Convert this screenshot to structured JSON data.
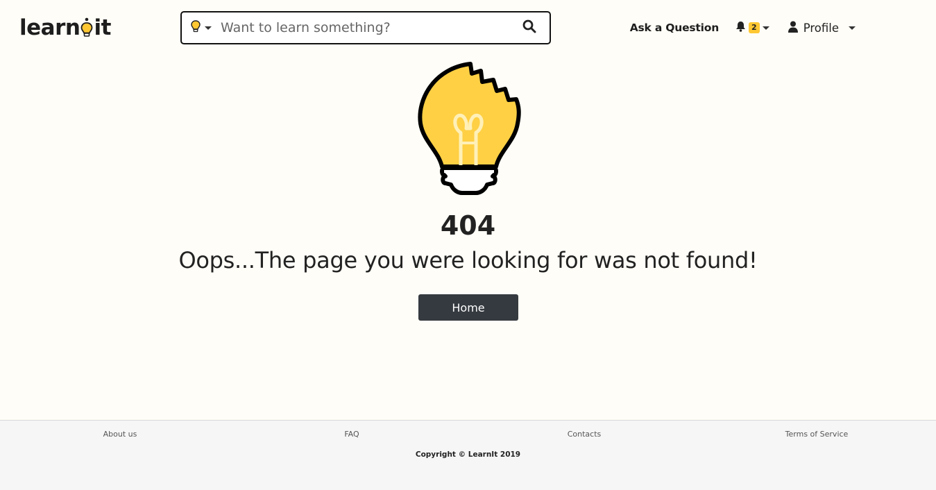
{
  "brand": {
    "logo_prefix": "learn",
    "logo_suffix": "it",
    "accent_color": "#ffc832",
    "dark_color": "#353a40"
  },
  "search": {
    "placeholder": "Want to learn something?",
    "value": "",
    "category_icon": "lightbulb-icon",
    "submit_icon": "search-icon"
  },
  "nav": {
    "ask_label": "Ask a Question",
    "notifications": {
      "icon": "bell-icon",
      "count": "2"
    },
    "profile": {
      "icon": "user-icon",
      "label": "Profile"
    }
  },
  "error": {
    "code": "404",
    "message": "Oops...The page you were looking for was not found!",
    "home_label": "Home",
    "illustration": "broken-lightbulb-icon"
  },
  "footer": {
    "links": [
      "About us",
      "FAQ",
      "Contacts",
      "Terms of Service"
    ],
    "copyright": "Copyright © LearnIt 2019"
  }
}
